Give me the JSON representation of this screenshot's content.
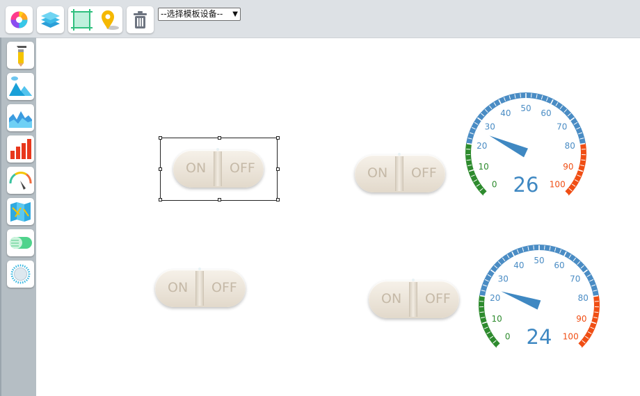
{
  "toolbar": {
    "template_select": {
      "selected": "--选择模板设备--"
    },
    "buttons": [
      "color-wheel-icon",
      "layers-icon",
      "crop-frame-icon",
      "map-pin-icon",
      "trash-icon"
    ]
  },
  "sidebar": {
    "tools": [
      "pencil-icon",
      "mountain-image-icon",
      "area-chart-icon",
      "bar-chart-icon",
      "gauge-icon",
      "map-icon",
      "toggle-switch-icon",
      "knob-icon"
    ]
  },
  "switches": [
    {
      "on_label": "ON",
      "off_label": "OFF",
      "selected": true
    },
    {
      "on_label": "ON",
      "off_label": "OFF",
      "selected": false
    },
    {
      "on_label": "ON",
      "off_label": "OFF",
      "selected": false
    },
    {
      "on_label": "ON",
      "off_label": "OFF",
      "selected": false
    }
  ],
  "gauges": [
    {
      "value": 26,
      "value_text": "26",
      "min": 0,
      "max": 100,
      "tick_labels": [
        "0",
        "10",
        "20",
        "30",
        "40",
        "50",
        "60",
        "70",
        "80",
        "90",
        "100"
      ],
      "zones": [
        {
          "from": 0,
          "to": 20,
          "color": "#2e8b2e"
        },
        {
          "from": 20,
          "to": 80,
          "color": "#4a8cc4"
        },
        {
          "from": 80,
          "to": 100,
          "color": "#f04e14"
        }
      ]
    },
    {
      "value": 24,
      "value_text": "24",
      "min": 0,
      "max": 100,
      "tick_labels": [
        "0",
        "10",
        "20",
        "30",
        "40",
        "50",
        "60",
        "70",
        "80",
        "90",
        "100"
      ],
      "zones": [
        {
          "from": 0,
          "to": 20,
          "color": "#2e8b2e"
        },
        {
          "from": 20,
          "to": 80,
          "color": "#4a8cc4"
        },
        {
          "from": 80,
          "to": 100,
          "color": "#f04e14"
        }
      ]
    }
  ]
}
